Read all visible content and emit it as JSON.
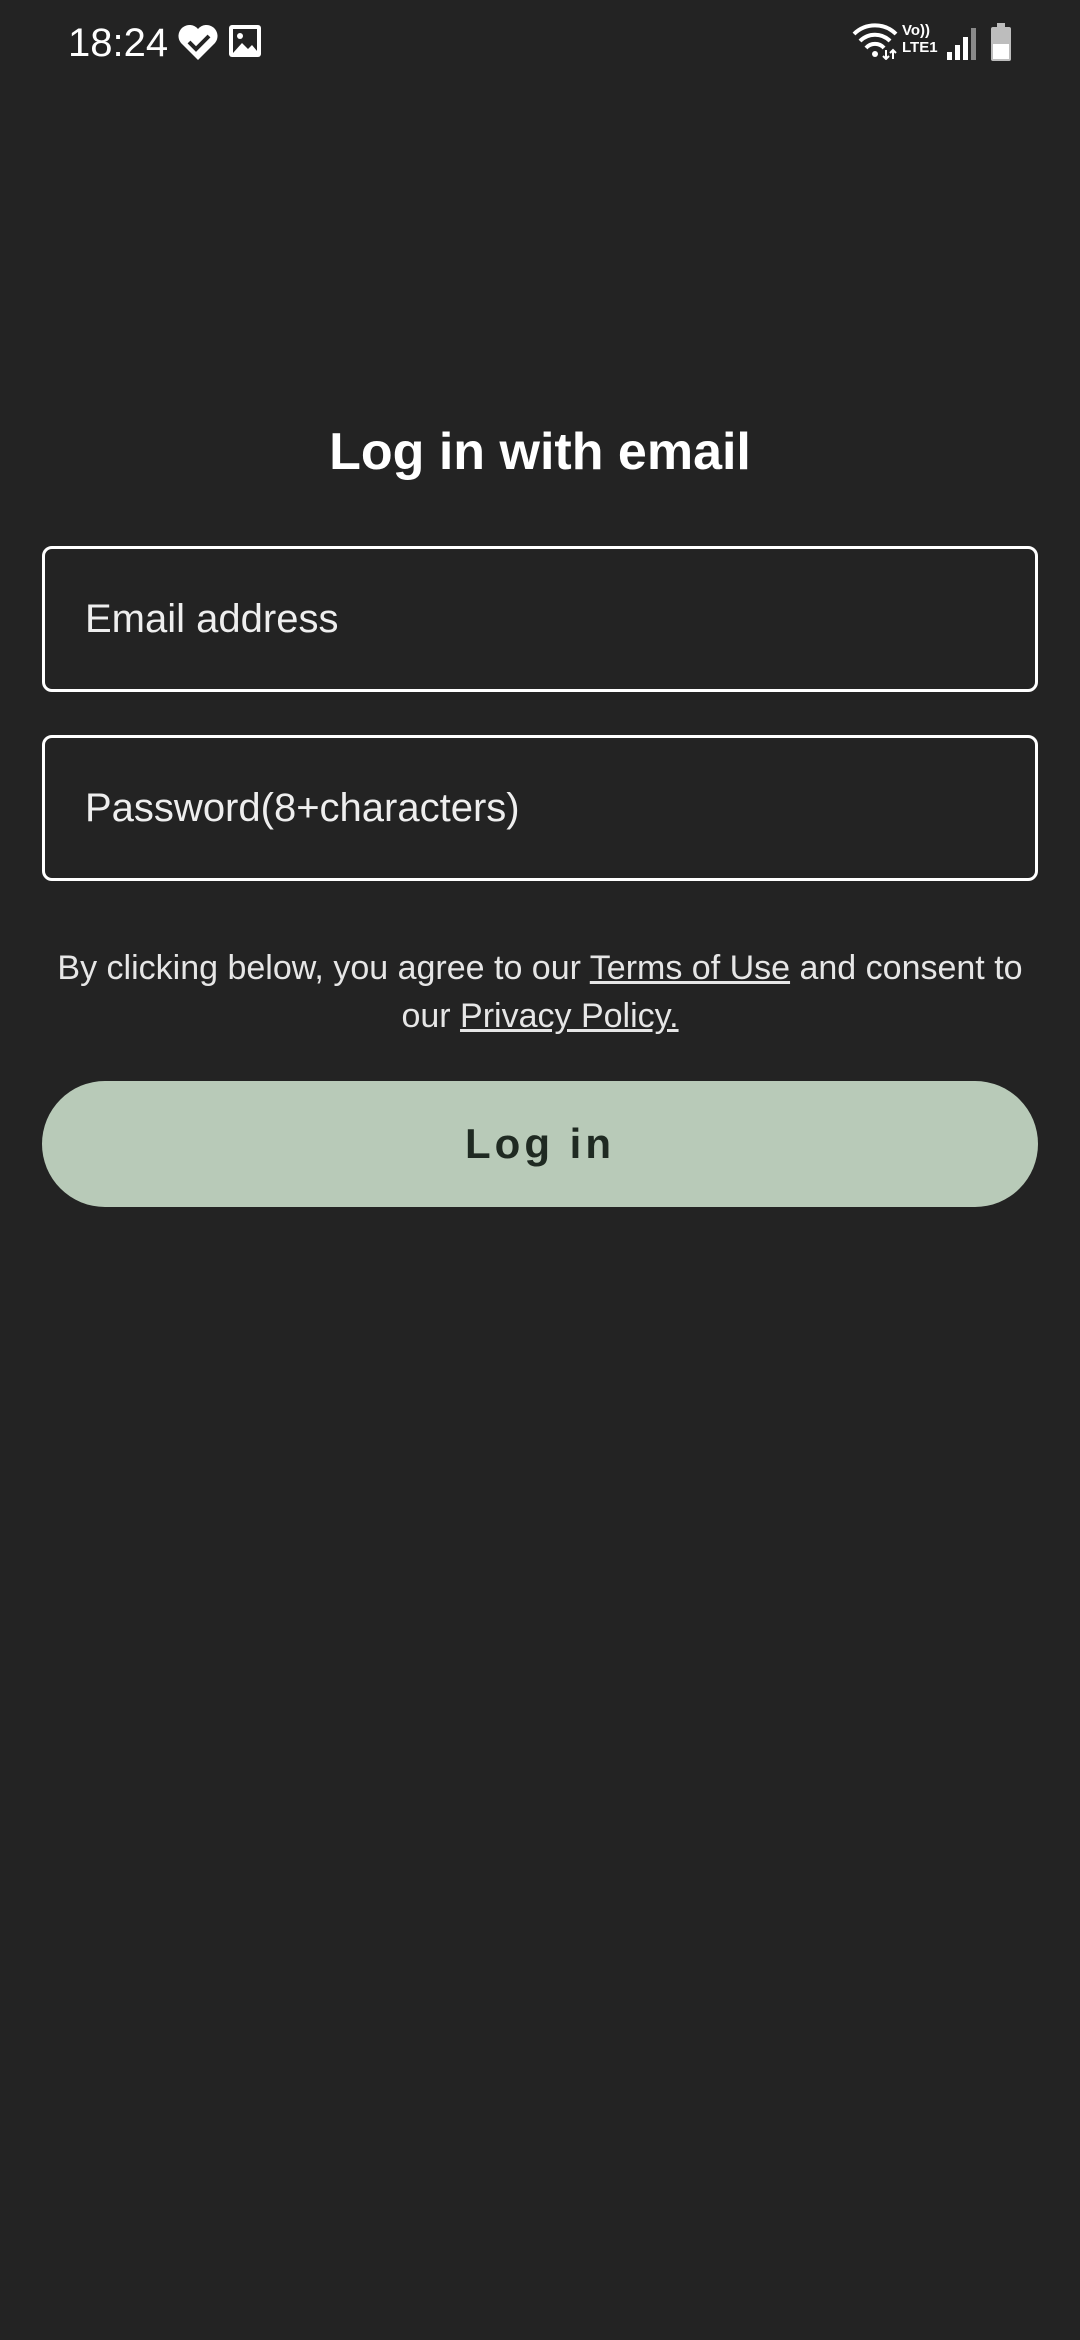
{
  "status_bar": {
    "time": "18:24",
    "left_icons": [
      "heart-check-icon",
      "image-icon"
    ],
    "right_icons": [
      "wifi-icon",
      "volte-icon",
      "signal-icon",
      "battery-icon"
    ],
    "volte_line1": "Vo))",
    "volte_line2": "LTE1"
  },
  "login": {
    "title": "Log in with email",
    "email_placeholder": "Email address",
    "password_placeholder": "Password(8+characters)",
    "consent_before": "By clicking below, you agree to our ",
    "terms_link": "Terms of Use",
    "consent_middle": " and consent to our ",
    "privacy_link": "Privacy Policy.",
    "button_label": "Log in"
  },
  "colors": {
    "background": "#232323",
    "button_bg": "#b8cab8",
    "button_text": "#1f2a22",
    "text": "#ffffff"
  }
}
